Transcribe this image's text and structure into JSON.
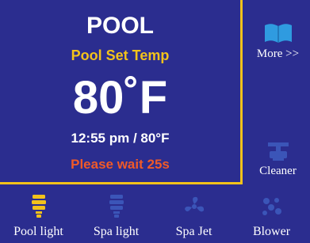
{
  "main": {
    "title": "POOL",
    "set_temp_label": "Pool Set Temp",
    "set_temp_value": "80˚F",
    "status_line": "12:55 pm / 80°F",
    "wait_message": "Please wait 25s"
  },
  "side": {
    "more_label": "More >>",
    "cleaner_label": "Cleaner"
  },
  "bottom": {
    "items": [
      {
        "label": "Pool light",
        "icon": "bulb-icon",
        "active": true
      },
      {
        "label": "Spa light",
        "icon": "bulb-icon",
        "active": false
      },
      {
        "label": "Spa Jet",
        "icon": "fan-icon",
        "active": false
      },
      {
        "label": "Blower",
        "icon": "bubbles-icon",
        "active": false
      }
    ]
  },
  "colors": {
    "background": "#2b2d8f",
    "accent": "#f2c21b",
    "warning": "#f05a28",
    "inactive_icon": "#3b55b8",
    "book_icon": "#2f9be0"
  }
}
